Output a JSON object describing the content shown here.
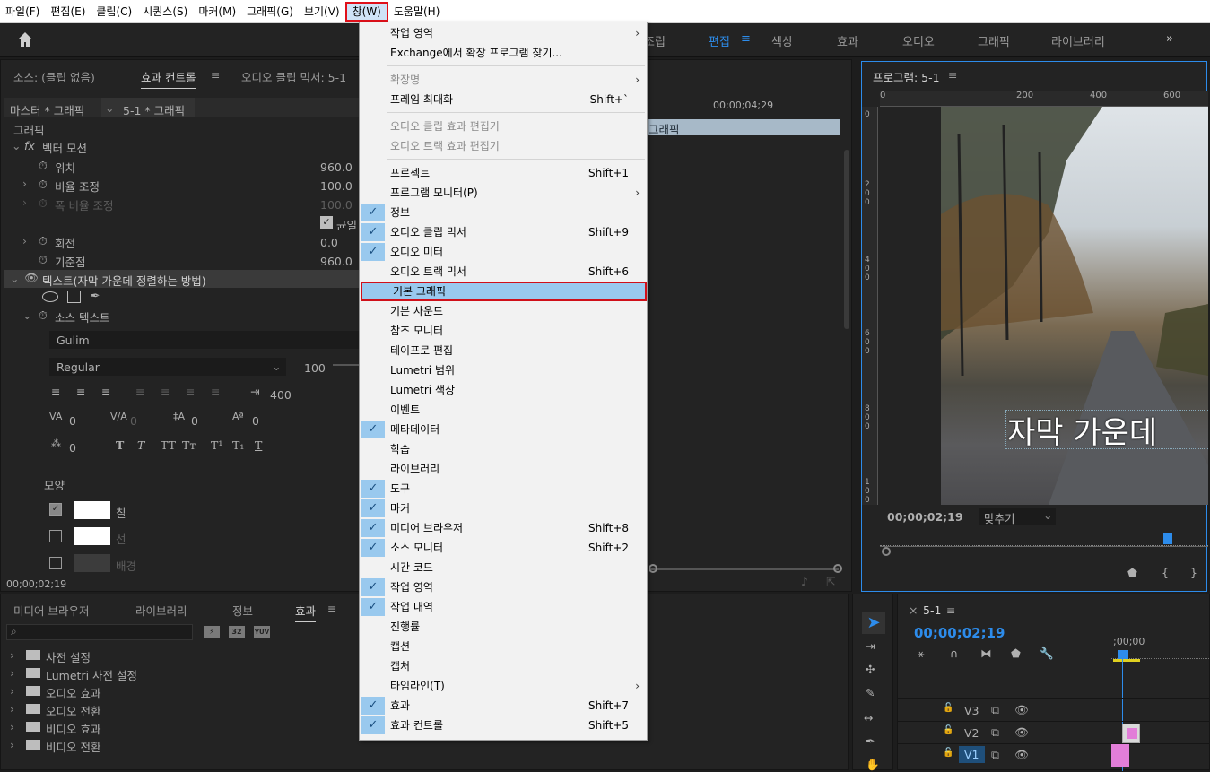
{
  "menubar": {
    "items": [
      "파일(F)",
      "편집(E)",
      "클립(C)",
      "시퀀스(S)",
      "마커(M)",
      "그래픽(G)",
      "보기(V)",
      "창(W)",
      "도움말(H)"
    ],
    "selected_index": 7
  },
  "workspaces": {
    "items": [
      "조립",
      "편집",
      "색상",
      "효과",
      "오디오",
      "그래픽",
      "라이브러리"
    ],
    "active": "편집",
    "more": "»"
  },
  "source_panel": {
    "tabs": [
      "소스: (클립 없음)",
      "효과 컨트롤",
      "오디오 클립 믹서: 5-1"
    ],
    "master_label": "마스터 * 그래픽",
    "clip_label": "5-1 * 그래픽",
    "section_graphic": "그래픽",
    "vector_motion": "벡터 모션",
    "props": [
      {
        "label": "위치",
        "value": "960.0"
      },
      {
        "label": "비율 조정",
        "value": "100.0"
      },
      {
        "label": "폭 비율 조정",
        "value": "100.0"
      },
      {
        "label": "균일 비율",
        "value": ""
      },
      {
        "label": "회전",
        "value": "0.0"
      },
      {
        "label": "기준점",
        "value": "960.0"
      }
    ],
    "text_layer": "텍스트(자막 가운데 정렬하는 방법)",
    "source_text": "소스 텍스트",
    "font": "Gulim",
    "style": "Regular",
    "size": "100",
    "tracking_width": "400",
    "metrics": [
      "0",
      "0",
      "0",
      "0",
      "0"
    ],
    "appearance": "모양",
    "fill": "칠",
    "stroke": "선",
    "background": "배경",
    "timecode": "00;00;02;19",
    "timeline_time": "00;00;04;29",
    "timeline_clip": "그래픽"
  },
  "program": {
    "title": "프로그램: 5-1",
    "ruler": [
      "0",
      "200",
      "400",
      "600"
    ],
    "vruler": [
      "0",
      "2 0 0",
      "4 0 0",
      "6 0 0",
      "8 0 0",
      "1 0 0"
    ],
    "caption": "자막 가운데",
    "timecode": "00;00;02;19",
    "fit": "맞추기"
  },
  "effects_panel": {
    "tabs": [
      "미디어 브라우저",
      "라이브러리",
      "정보",
      "효과"
    ],
    "badges": [
      "32",
      "YUV"
    ],
    "folders": [
      "사전 설정",
      "Lumetri 사전 설정",
      "오디오 효과",
      "오디오 전환",
      "비디오 효과",
      "비디오 전환"
    ]
  },
  "timeline": {
    "tab": "5-1",
    "timecode": "00;00;02;19",
    "ruler_time": ";00;00",
    "tracks": [
      "V3",
      "V2",
      "V1"
    ]
  },
  "window_menu": {
    "items": [
      {
        "label": "작업 영역",
        "shortcut": "",
        "submenu": true,
        "checked": false,
        "disabled": false
      },
      {
        "label": "Exchange에서 확장 프로그램 찾기...",
        "shortcut": "",
        "submenu": false,
        "checked": false,
        "disabled": false
      },
      {
        "label": "확장명",
        "shortcut": "",
        "submenu": true,
        "checked": false,
        "disabled": true
      },
      {
        "label": "프레임 최대화",
        "shortcut": "Shift+`",
        "submenu": false,
        "checked": false,
        "disabled": false
      },
      {
        "label": "오디오 클립 효과 편집기",
        "shortcut": "",
        "submenu": false,
        "checked": false,
        "disabled": true
      },
      {
        "label": "오디오 트랙 효과 편집기",
        "shortcut": "",
        "submenu": false,
        "checked": false,
        "disabled": true
      },
      {
        "label": "프로젝트",
        "shortcut": "Shift+1",
        "submenu": false,
        "checked": false,
        "disabled": false
      },
      {
        "label": "프로그램 모니터(P)",
        "shortcut": "",
        "submenu": true,
        "checked": false,
        "disabled": false
      },
      {
        "label": "정보",
        "shortcut": "",
        "submenu": false,
        "checked": true,
        "disabled": false
      },
      {
        "label": "오디오 클립 믹서",
        "shortcut": "Shift+9",
        "submenu": false,
        "checked": true,
        "disabled": false
      },
      {
        "label": "오디오 미터",
        "shortcut": "",
        "submenu": false,
        "checked": true,
        "disabled": false
      },
      {
        "label": "오디오 트랙 믹서",
        "shortcut": "Shift+6",
        "submenu": false,
        "checked": false,
        "disabled": false
      },
      {
        "label": "기본 그래픽",
        "shortcut": "",
        "submenu": false,
        "checked": false,
        "disabled": false,
        "highlighted": true
      },
      {
        "label": "기본 사운드",
        "shortcut": "",
        "submenu": false,
        "checked": false,
        "disabled": false
      },
      {
        "label": "참조 모니터",
        "shortcut": "",
        "submenu": false,
        "checked": false,
        "disabled": false
      },
      {
        "label": "테이프로 편집",
        "shortcut": "",
        "submenu": false,
        "checked": false,
        "disabled": false
      },
      {
        "label": "Lumetri 범위",
        "shortcut": "",
        "submenu": false,
        "checked": false,
        "disabled": false
      },
      {
        "label": "Lumetri 색상",
        "shortcut": "",
        "submenu": false,
        "checked": false,
        "disabled": false
      },
      {
        "label": "이벤트",
        "shortcut": "",
        "submenu": false,
        "checked": false,
        "disabled": false
      },
      {
        "label": "메타데이터",
        "shortcut": "",
        "submenu": false,
        "checked": true,
        "disabled": false
      },
      {
        "label": "학습",
        "shortcut": "",
        "submenu": false,
        "checked": false,
        "disabled": false
      },
      {
        "label": "라이브러리",
        "shortcut": "",
        "submenu": false,
        "checked": false,
        "disabled": false
      },
      {
        "label": "도구",
        "shortcut": "",
        "submenu": false,
        "checked": true,
        "disabled": false
      },
      {
        "label": "마커",
        "shortcut": "",
        "submenu": false,
        "checked": true,
        "disabled": false
      },
      {
        "label": "미디어 브라우저",
        "shortcut": "Shift+8",
        "submenu": false,
        "checked": true,
        "disabled": false
      },
      {
        "label": "소스 모니터",
        "shortcut": "Shift+2",
        "submenu": false,
        "checked": true,
        "disabled": false
      },
      {
        "label": "시간 코드",
        "shortcut": "",
        "submenu": false,
        "checked": false,
        "disabled": false
      },
      {
        "label": "작업 영역",
        "shortcut": "",
        "submenu": false,
        "checked": true,
        "disabled": false
      },
      {
        "label": "작업 내역",
        "shortcut": "",
        "submenu": false,
        "checked": true,
        "disabled": false
      },
      {
        "label": "진행률",
        "shortcut": "",
        "submenu": false,
        "checked": false,
        "disabled": false
      },
      {
        "label": "캡션",
        "shortcut": "",
        "submenu": false,
        "checked": false,
        "disabled": false
      },
      {
        "label": "캡처",
        "shortcut": "",
        "submenu": false,
        "checked": false,
        "disabled": false
      },
      {
        "label": "타임라인(T)",
        "shortcut": "",
        "submenu": true,
        "checked": false,
        "disabled": false
      },
      {
        "label": "효과",
        "shortcut": "Shift+7",
        "submenu": false,
        "checked": true,
        "disabled": false
      },
      {
        "label": "효과 컨트롤",
        "shortcut": "Shift+5",
        "submenu": false,
        "checked": true,
        "disabled": false
      }
    ]
  }
}
